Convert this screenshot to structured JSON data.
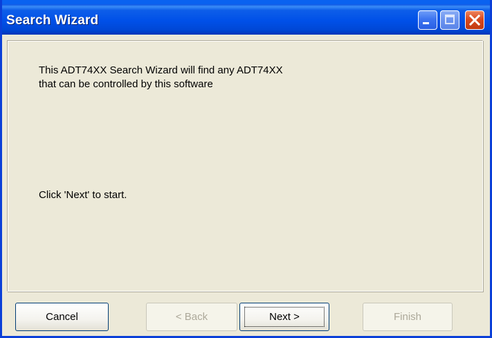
{
  "window": {
    "title": "Search Wizard"
  },
  "titlebar_buttons": {
    "minimize_icon": "minimize-icon",
    "maximize_icon": "maximize-icon",
    "close_icon": "close-icon"
  },
  "content": {
    "intro_text": "This ADT74XX Search Wizard will find any ADT74XX that can be controlled by this software",
    "start_text": "Click 'Next' to start."
  },
  "buttons": {
    "cancel": "Cancel",
    "back": "< Back",
    "next": "Next >",
    "finish": "Finish"
  },
  "colors": {
    "titlebar": "#0050e8",
    "window_bg": "#ece9d8",
    "close_button": "#d8491f",
    "disabled_text": "#aca899"
  }
}
